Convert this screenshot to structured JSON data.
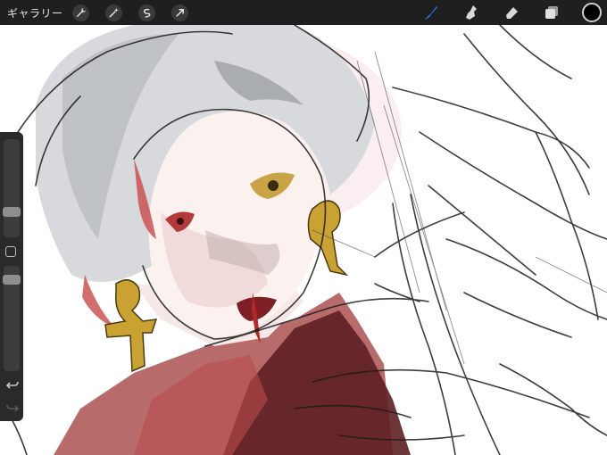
{
  "toolbar": {
    "gallery_label": "ギャラリー",
    "left_tools": [
      "wrench-icon",
      "magic-wand-icon",
      "selection-icon",
      "transform-arrow-icon"
    ],
    "right_tools": [
      "brush-icon",
      "smudge-icon",
      "eraser-icon",
      "layers-icon"
    ],
    "active_tool": "brush",
    "active_color": "#1e6bd6",
    "current_color": "#000000"
  },
  "sidebar": {
    "brush_size_slider": "brush-size-slider",
    "opacity_slider": "opacity-slider",
    "modify_button": "eyedropper-square-icon",
    "undo": "undo-icon",
    "redo": "redo-icon"
  }
}
